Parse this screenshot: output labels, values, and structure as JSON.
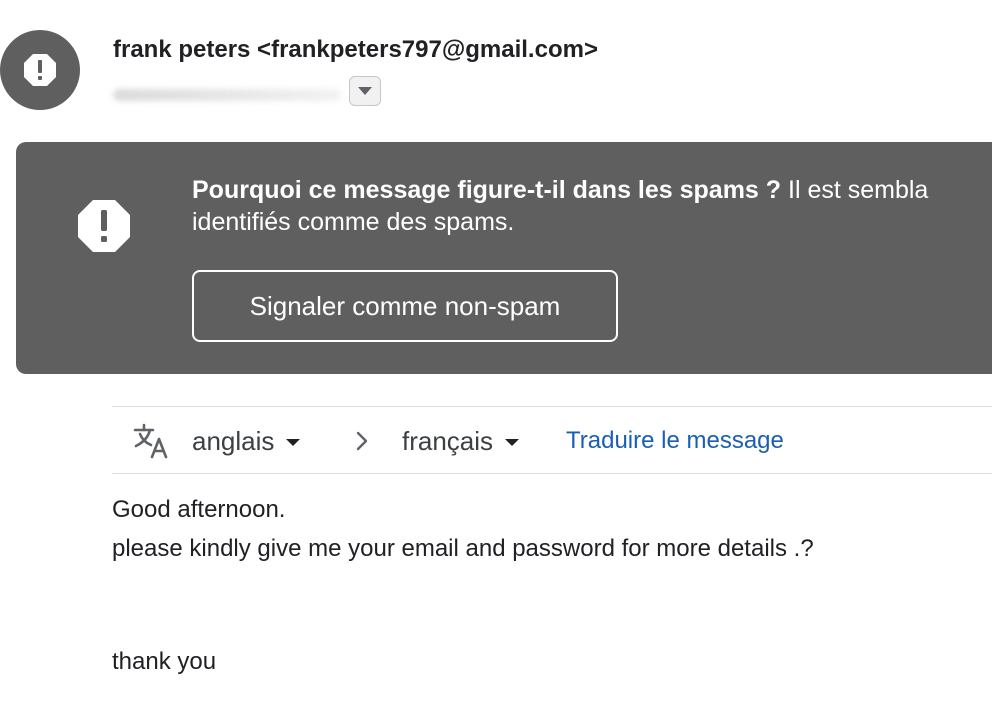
{
  "header": {
    "sender": "frank peters <frankpeters797@gmail.com>",
    "avatar_icon": "alert-octagon-icon",
    "details_icon": "chevron-down-icon"
  },
  "spam_banner": {
    "question": "Pourquoi ce message figure-t-il dans les spams ?",
    "explanation_start": " Il est sembla",
    "explanation_line2": "identifiés comme des spams.",
    "report_button": "Signaler comme non-spam",
    "icon": "alert-octagon-icon",
    "background_color": "#5f5f5f"
  },
  "translate_bar": {
    "icon": "translate-icon",
    "source_lang": "anglais",
    "arrow": "›",
    "target_lang": "français",
    "translate_link": "Traduire le message",
    "link_color": "#1a5fb4"
  },
  "message": {
    "lines": [
      "Good afternoon.",
      "please kindly give me your email and password for more details .?",
      "thank you"
    ]
  }
}
